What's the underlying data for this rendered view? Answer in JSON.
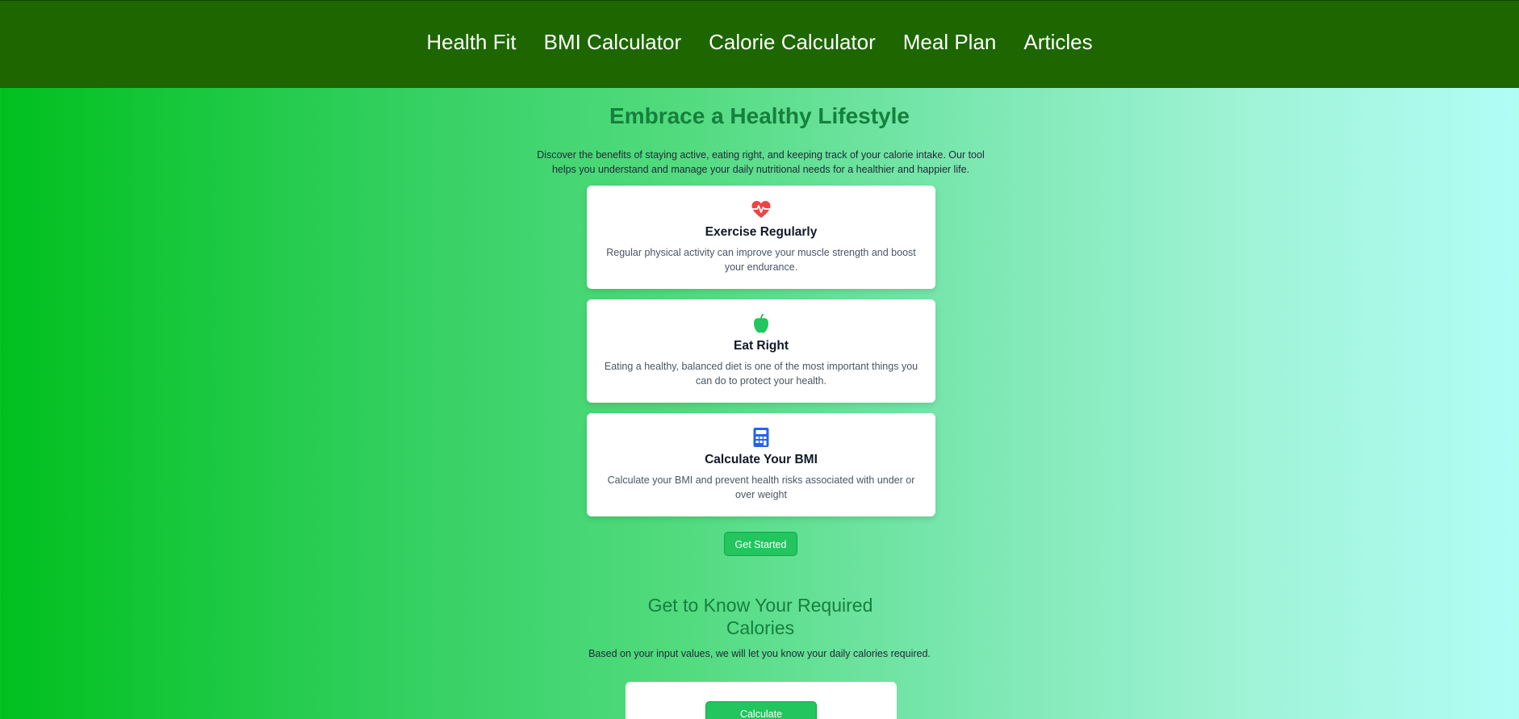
{
  "nav": {
    "items": [
      {
        "label": "Health Fit"
      },
      {
        "label": "BMI Calculator"
      },
      {
        "label": "Calorie Calculator"
      },
      {
        "label": "Meal Plan"
      },
      {
        "label": "Articles"
      }
    ]
  },
  "hero": {
    "title": "Embrace a Healthy Lifestyle",
    "description": "Discover the benefits of staying active, eating right, and keeping track of your calorie intake. Our tool helps you understand and manage your daily nutritional needs for a healthier and happier life."
  },
  "cards": [
    {
      "icon": "heart-pulse-icon",
      "title": "Exercise Regularly",
      "text": "Regular physical activity can improve your muscle strength and boost your endurance."
    },
    {
      "icon": "apple-icon",
      "title": "Eat Right",
      "text": "Eating a healthy, balanced diet is one of the most important things you can do to protect your health."
    },
    {
      "icon": "calculator-icon",
      "title": "Calculate Your BMI",
      "text": "Calculate your BMI and prevent health risks associated with under or over weight"
    }
  ],
  "get_started_label": "Get Started",
  "calories_section": {
    "title": "Get to Know Your Required Calories",
    "description": "Based on your input values, we will let you know your daily calories required.",
    "calculate_label": "Calculate"
  },
  "colors": {
    "navbar": "#1d6600",
    "accent": "#22c55e",
    "heading": "#15803d",
    "heart": "#ef4444",
    "apple": "#22c55e",
    "calculator": "#2563eb"
  }
}
